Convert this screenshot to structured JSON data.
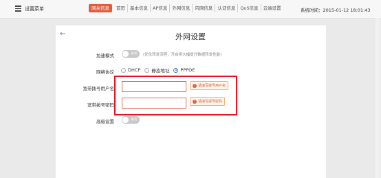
{
  "header": {
    "menu_label": "设置菜单",
    "nav": [
      "网关信息",
      "首页",
      "基本信息",
      "AP信息",
      "外网信息",
      "内网信息",
      "认证信息",
      "QoS信息",
      "云端设置"
    ],
    "system_time": "系统时间：2015-01-12 18:01:43"
  },
  "page": {
    "title": "外网设置",
    "back_icon": "arrow-left-icon"
  },
  "form": {
    "accel_label": "加速模式",
    "accel_toggle": "关闭",
    "accel_hint": "(优化转发流程，开启将大幅提升数据转发性能)",
    "protocol_label": "网络协议",
    "protocol_options": [
      "DHCP",
      "静态地址",
      "PPPOE"
    ],
    "protocol_selected": "PPPOE",
    "user_label": "宽带拨号用户名",
    "user_value": "",
    "user_error": "请填写拨号用户名",
    "pass_label": "宽带拨号密码",
    "pass_value": "",
    "pass_error": "请填写拨号密码",
    "advanced_label": "高级设置",
    "advanced_toggle": "关闭"
  },
  "colors": {
    "accent": "#e35b3b",
    "link": "#3a7bd5",
    "highlight_box": "#e8131b"
  }
}
